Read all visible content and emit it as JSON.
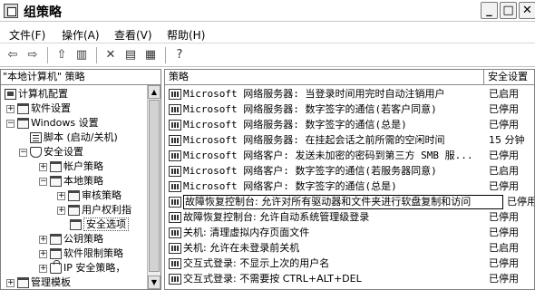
{
  "window": {
    "title": "组策略",
    "controls": [
      "_",
      "□",
      "✕"
    ]
  },
  "menu": [
    "文件(F)",
    "操作(A)",
    "查看(V)",
    "帮助(H)"
  ],
  "left_pane": {
    "header": "\"本地计算机\" 策略",
    "tree": [
      {
        "label": "计算机配置",
        "expander": "",
        "icon": "computer"
      },
      {
        "label": "软件设置",
        "expander": "+",
        "icon": "folder"
      },
      {
        "label": "Windows 设置",
        "expander": "−",
        "icon": "folder"
      },
      {
        "label": "脚本 (启动/关机)",
        "expander": "",
        "icon": "doc"
      },
      {
        "label": "安全设置",
        "expander": "−",
        "icon": "shield"
      },
      {
        "label": "帐户策略",
        "expander": "+",
        "icon": "folder"
      },
      {
        "label": "本地策略",
        "expander": "−",
        "icon": "folder"
      },
      {
        "label": "审核策略",
        "expander": "+",
        "icon": "folder"
      },
      {
        "label": "用户权利指",
        "expander": "+",
        "icon": "folder"
      },
      {
        "label": "安全选项",
        "expander": "",
        "icon": "folder"
      },
      {
        "label": "公钥策略",
        "expander": "+",
        "icon": "folder"
      },
      {
        "label": "软件限制策略",
        "expander": "+",
        "icon": "folder"
      },
      {
        "label": "IP 安全策略，",
        "expander": "+",
        "icon": "lock"
      },
      {
        "label": "管理模板",
        "expander": "+",
        "icon": "folder"
      }
    ]
  },
  "right_pane": {
    "columns": [
      "策略",
      "安全设置"
    ],
    "rows": [
      {
        "policy": "Microsoft 网络服务器: 当登录时间用完时自动注销用户",
        "setting": "已启用"
      },
      {
        "policy": "Microsoft 网络服务器: 数字签字的通信(若客户同意)",
        "setting": "已停用"
      },
      {
        "policy": "Microsoft 网络服务器: 数字签字的通信(总是)",
        "setting": "已停用"
      },
      {
        "policy": "Microsoft 网络服务器: 在挂起会话之前所需的空闲时间",
        "setting": "15 分钟"
      },
      {
        "policy": "Microsoft 网络客户: 发送未加密的密码到第三方 SMB 服...",
        "setting": "已停用"
      },
      {
        "policy": "Microsoft 网络客户: 数字签字的通信(若服务器同意)",
        "setting": "已启用"
      },
      {
        "policy": "Microsoft 网络客户: 数字签字的通信(总是)",
        "setting": "已停用"
      },
      {
        "policy": "故障恢复控制台: 允许对所有驱动器和文件夹进行软盘复制和访问",
        "setting": "已停用"
      },
      {
        "policy": "故障恢复控制台: 允许自动系统管理级登录",
        "setting": "已停用"
      },
      {
        "policy": "关机: 清理虚拟内存页面文件",
        "setting": "已停用"
      },
      {
        "policy": "关机: 允许在未登录前关机",
        "setting": "已启用"
      },
      {
        "policy": "交互式登录: 不显示上次的用户名",
        "setting": "已停用"
      },
      {
        "policy": "交互式登录: 不需要按 CTRL+ALT+DEL",
        "setting": "已停用"
      }
    ]
  }
}
